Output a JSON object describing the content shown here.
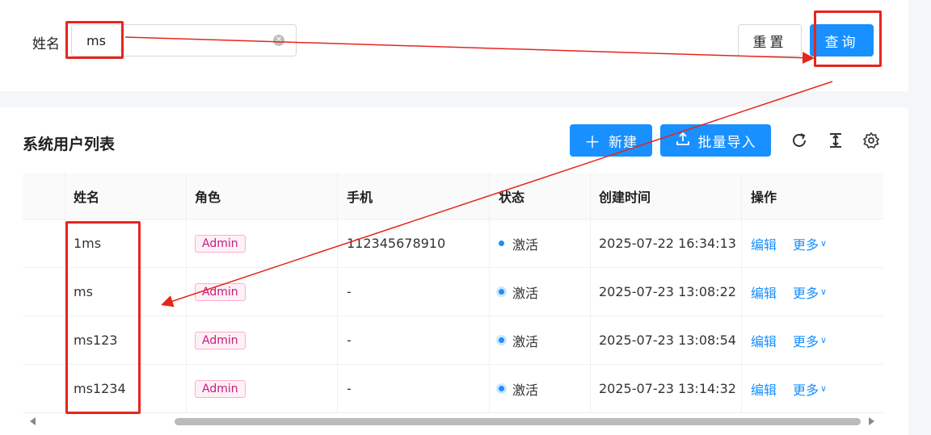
{
  "search": {
    "label": "姓名",
    "value": "ms",
    "reset_label": "重置",
    "query_label": "查询"
  },
  "list": {
    "title": "系统用户列表",
    "new_label": "新建",
    "import_label": "批量导入"
  },
  "table": {
    "headers": [
      "姓名",
      "角色",
      "手机",
      "状态",
      "创建时间",
      "操作"
    ],
    "rows": [
      {
        "name": "1ms",
        "role": "Admin",
        "phone": "112345678910",
        "status": "激活",
        "created": "2025-07-22 16:34:13",
        "edit": "编辑",
        "more": "更多"
      },
      {
        "name": "ms",
        "role": "Admin",
        "phone": "-",
        "status": "激活",
        "created": "2025-07-23 13:08:22",
        "edit": "编辑",
        "more": "更多"
      },
      {
        "name": "ms123",
        "role": "Admin",
        "phone": "-",
        "status": "激活",
        "created": "2025-07-23 13:08:54",
        "edit": "编辑",
        "more": "更多"
      },
      {
        "name": "ms1234",
        "role": "Admin",
        "phone": "-",
        "status": "激活",
        "created": "2025-07-23 13:14:32",
        "edit": "编辑",
        "more": "更多"
      }
    ]
  },
  "colors": {
    "primary": "#1890ff",
    "annotation": "#e6251e",
    "tag_text": "#c41d7f"
  }
}
